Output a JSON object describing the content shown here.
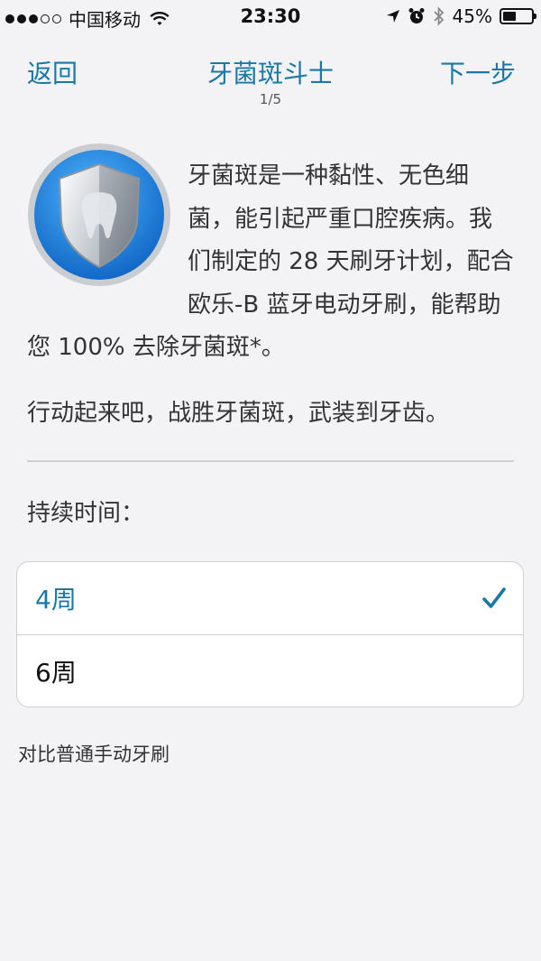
{
  "status_bar": {
    "carrier": "中国移动",
    "time": "23:30",
    "battery": "45%",
    "battery_level": 0.45,
    "signal_bars_filled": 3,
    "signal_bars_total": 5
  },
  "nav": {
    "back_label": "返回",
    "title": "牙菌斑斗士",
    "step": "1/5",
    "next_label": "下一步"
  },
  "intro_text": "牙菌斑是一种黏性、无色细菌，能引起严重口腔疾病。我们制定的 28 天刷牙计划，配合欧乐-B 蓝牙电动牙刷，能帮助您 100% 去除牙菌斑*。",
  "action_text": "行动起来吧，战胜牙菌斑，武装到牙齿。",
  "duration_label": "持续时间：",
  "options": [
    {
      "label": "4周",
      "selected": true
    },
    {
      "label": "6周",
      "selected": false
    }
  ],
  "compare_text": "对比普通手动牙刷",
  "colors": {
    "accent": "#1a78a6",
    "background": "#f3f3f6",
    "badge_blue": "#1e7fd6"
  }
}
